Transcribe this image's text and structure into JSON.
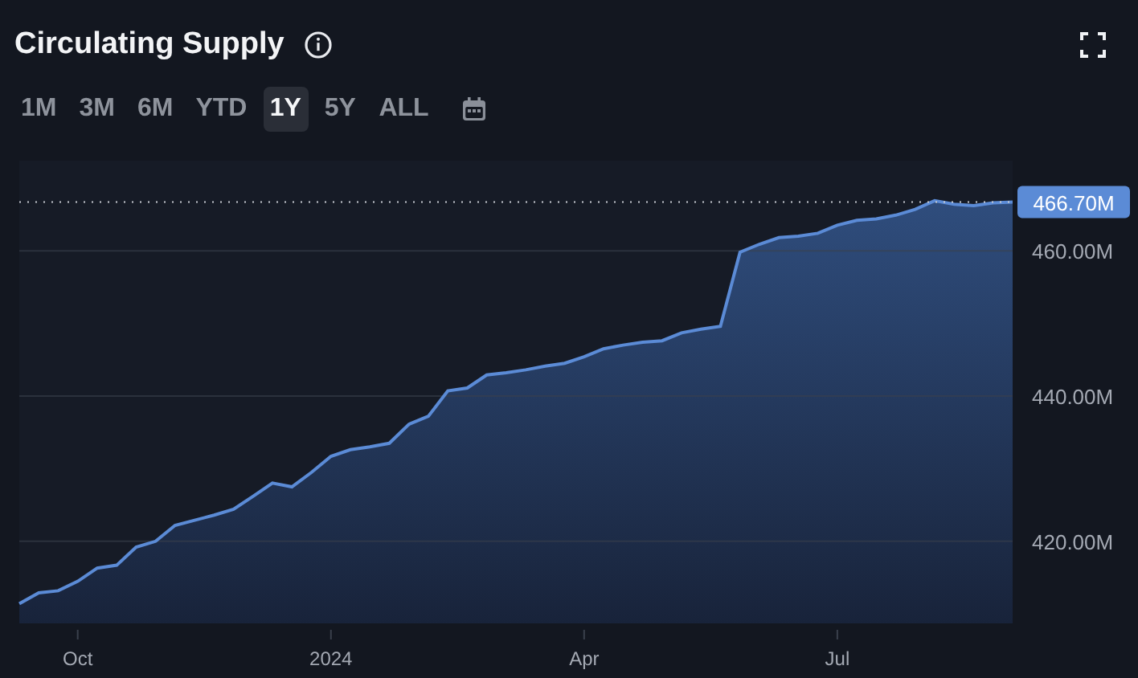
{
  "title": "Circulating Supply",
  "ranges": [
    {
      "label": "1M",
      "selected": false
    },
    {
      "label": "3M",
      "selected": false
    },
    {
      "label": "6M",
      "selected": false
    },
    {
      "label": "YTD",
      "selected": false
    },
    {
      "label": "1Y",
      "selected": true
    },
    {
      "label": "5Y",
      "selected": false
    },
    {
      "label": "ALL",
      "selected": false
    }
  ],
  "chart_data": {
    "type": "area",
    "categories": [
      null,
      null,
      null,
      "Oct",
      null,
      null,
      null,
      null,
      null,
      null,
      null,
      null,
      null,
      null,
      null,
      null,
      "2024",
      null,
      null,
      null,
      null,
      null,
      null,
      null,
      null,
      null,
      null,
      null,
      null,
      "Apr",
      null,
      null,
      null,
      null,
      null,
      null,
      null,
      null,
      null,
      null,
      null,
      null,
      "Jul",
      null,
      null,
      null,
      null,
      null,
      null,
      null,
      null,
      null
    ],
    "series": [
      {
        "color": "#5b8bd6",
        "values": [
          411.4,
          412.9,
          413.2,
          414.5,
          416.3,
          416.7,
          419.2,
          420,
          422.2,
          422.9,
          423.6,
          424.4,
          426.2,
          428,
          427.5,
          429.5,
          431.7,
          432.6,
          433,
          433.5,
          436.1,
          437.2,
          440.7,
          441.1,
          442.9,
          443.2,
          443.6,
          444.1,
          444.5,
          445.4,
          446.5,
          447,
          447.4,
          447.6,
          448.7,
          449.2,
          449.6,
          459.8,
          460.9,
          461.8,
          462,
          462.4,
          463.5,
          464.2,
          464.4,
          464.9,
          465.7,
          466.9,
          466.4,
          466.2,
          466.6,
          466.7
        ]
      }
    ],
    "ylim": [
      408.7,
      472.4
    ],
    "yticks": [
      {
        "value": 420,
        "label": "420.00M"
      },
      {
        "value": 440,
        "label": "440.00M"
      },
      {
        "value": 460,
        "label": "460.00M"
      }
    ],
    "grid": true,
    "ref_lines": [
      {
        "axis": "y",
        "value": 466.7,
        "label": "466.70M"
      }
    ]
  }
}
